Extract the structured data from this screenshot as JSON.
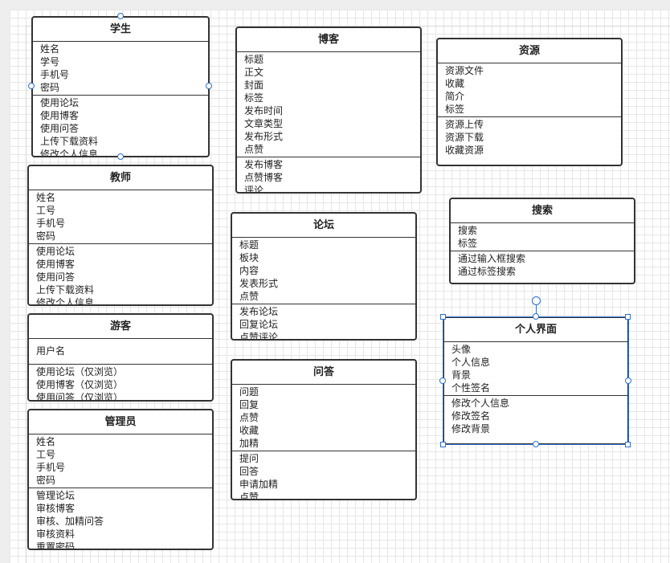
{
  "classes": {
    "student": {
      "title": "学生",
      "attributes": [
        "姓名",
        "学号",
        "手机号",
        "密码"
      ],
      "methods": [
        "使用论坛",
        "使用博客",
        "使用问答",
        "上传下载资料",
        "修改个人信息"
      ]
    },
    "teacher": {
      "title": "教师",
      "attributes": [
        "姓名",
        "工号",
        "手机号",
        "密码"
      ],
      "methods": [
        "使用论坛",
        "使用博客",
        "使用问答",
        "上传下载资料",
        "修改个人信息"
      ]
    },
    "visitor": {
      "title": "游客",
      "attributes": [
        "用户名"
      ],
      "methods": [
        "使用论坛（仅浏览）",
        "使用博客（仅浏览）",
        "使用问答（仅浏览）"
      ]
    },
    "admin": {
      "title": "管理员",
      "attributes": [
        "姓名",
        "工号",
        "手机号",
        "密码"
      ],
      "methods": [
        "管理论坛",
        "审核博客",
        "审核、加精问答",
        "审核资料",
        "重置密码"
      ]
    },
    "blog": {
      "title": "博客",
      "attributes": [
        "标题",
        "正文",
        "封面",
        "标签",
        "发布时间",
        "文章类型",
        "发布形式",
        "点赞"
      ],
      "methods": [
        "发布博客",
        "点赞博客",
        "评论"
      ]
    },
    "forum": {
      "title": "论坛",
      "attributes": [
        "标题",
        "板块",
        "内容",
        "发表形式",
        "点赞"
      ],
      "methods": [
        "发布论坛",
        "回复论坛",
        "点赞评论"
      ]
    },
    "qa": {
      "title": "问答",
      "attributes": [
        "问题",
        "回复",
        "点赞",
        "收藏",
        "加精"
      ],
      "methods": [
        "提问",
        "回答",
        "申请加精",
        "点赞"
      ]
    },
    "resource": {
      "title": "资源",
      "attributes": [
        "资源文件",
        "收藏",
        "简介",
        "标签"
      ],
      "methods": [
        "资源上传",
        "资源下载",
        "收藏资源"
      ]
    },
    "search": {
      "title": "搜索",
      "attributes": [
        "搜索",
        "标签"
      ],
      "methods": [
        "通过输入框搜索",
        "通过标签搜索"
      ]
    },
    "profile": {
      "title": "个人界面",
      "attributes": [
        "头像",
        "个人信息",
        "背景",
        "个性签名"
      ],
      "methods": [
        "修改个人信息",
        "修改签名",
        "修改背景"
      ]
    }
  },
  "colors": {
    "border": "#333333",
    "selection": "#2a6fd6",
    "grid": "#e6e6e6"
  }
}
